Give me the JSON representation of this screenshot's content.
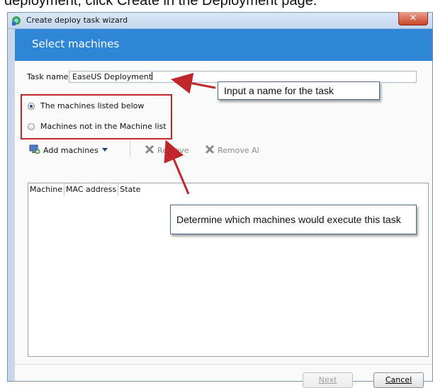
{
  "top_caption": "deployment, click Create in the Deployment page.",
  "window": {
    "title": "Create deploy task wizard",
    "close_glyph": "✕",
    "banner_title": "Select machines"
  },
  "form": {
    "task_name_label": "Task name:",
    "task_name_value": "EaseUS Deployment",
    "radio_options": [
      {
        "label": "The machines listed below",
        "selected": true
      },
      {
        "label": "Machines not in the Machine list",
        "selected": false
      }
    ]
  },
  "toolbar": {
    "add_label": "Add machines",
    "remove_label": "Remove",
    "remove_all_label": "Remove Al"
  },
  "grid": {
    "columns": [
      "Machine",
      "MAC address",
      "State"
    ]
  },
  "buttons": {
    "next": "Next",
    "cancel": "Cancel"
  },
  "callouts": {
    "name": "Input a name for the task",
    "machines": "Determine which machines would execute this task"
  },
  "colors": {
    "banner": "#2f86d6",
    "annotation_red": "#c0272d"
  },
  "icons": [
    "app-icon",
    "add-machines-icon",
    "remove-icon",
    "remove-all-icon",
    "dropdown-arrow-icon"
  ]
}
